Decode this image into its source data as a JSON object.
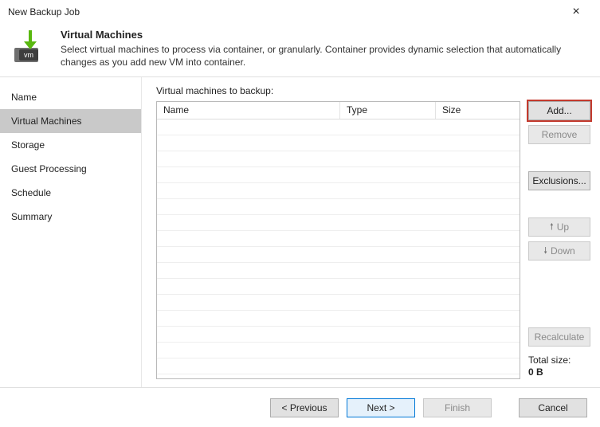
{
  "window": {
    "title": "New Backup Job",
    "close_glyph": "×"
  },
  "header": {
    "title": "Virtual Machines",
    "subtitle": "Select virtual machines to process via container, or granularly. Container provides dynamic selection that automatically changes as you add new VM into container."
  },
  "sidebar": {
    "steps": [
      {
        "label": "Name",
        "active": false
      },
      {
        "label": "Virtual Machines",
        "active": true
      },
      {
        "label": "Storage",
        "active": false
      },
      {
        "label": "Guest Processing",
        "active": false
      },
      {
        "label": "Schedule",
        "active": false
      },
      {
        "label": "Summary",
        "active": false
      }
    ]
  },
  "main": {
    "list_label": "Virtual machines to backup:",
    "columns": {
      "name": "Name",
      "type": "Type",
      "size": "Size"
    },
    "rows": [],
    "total_label": "Total size:",
    "total_value": "0 B"
  },
  "actions": {
    "add": "Add...",
    "remove": "Remove",
    "exclusions": "Exclusions...",
    "up": "Up",
    "down": "Down",
    "recalculate": "Recalculate"
  },
  "footer": {
    "previous": "< Previous",
    "next": "Next >",
    "finish": "Finish",
    "cancel": "Cancel"
  },
  "icons": {
    "app_badge": "vm"
  }
}
